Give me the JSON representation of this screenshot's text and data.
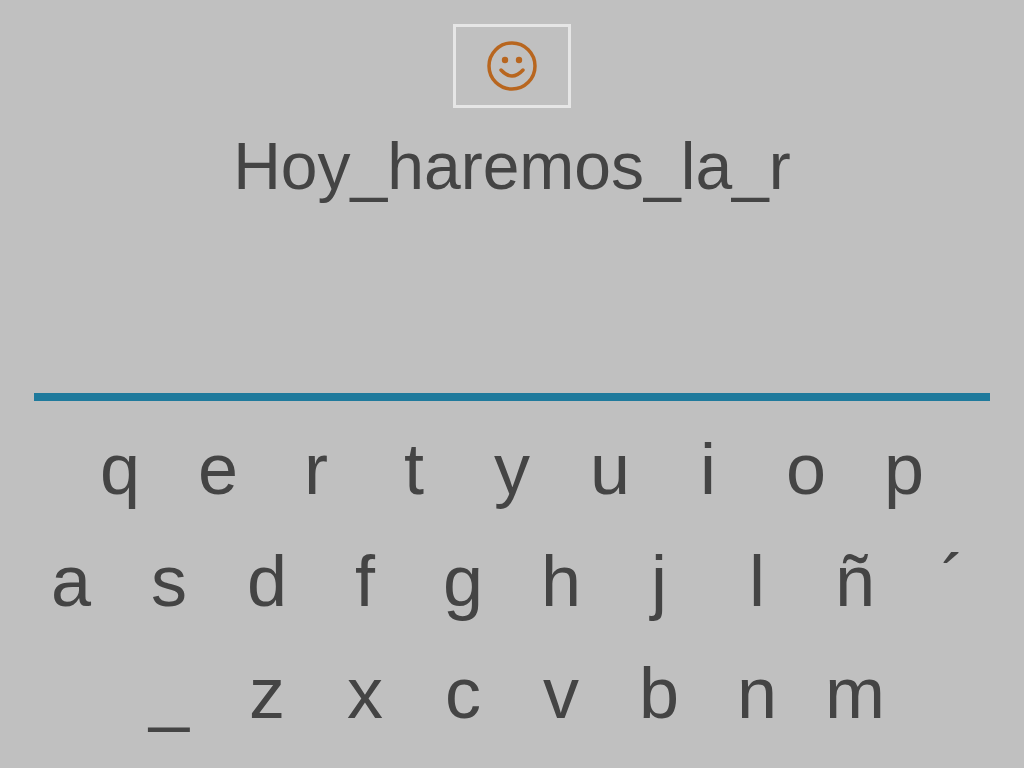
{
  "answer": "Hoy_haremos_la_r",
  "keyboard": [
    [
      "q",
      "e",
      "r",
      "t",
      "y",
      "u",
      "i",
      "o",
      "p"
    ],
    [
      "a",
      "s",
      "d",
      "f",
      "g",
      "h",
      "j",
      "l",
      "ñ",
      "´"
    ],
    [
      "_",
      "z",
      "x",
      "c",
      "v",
      "b",
      "n",
      "m"
    ]
  ]
}
